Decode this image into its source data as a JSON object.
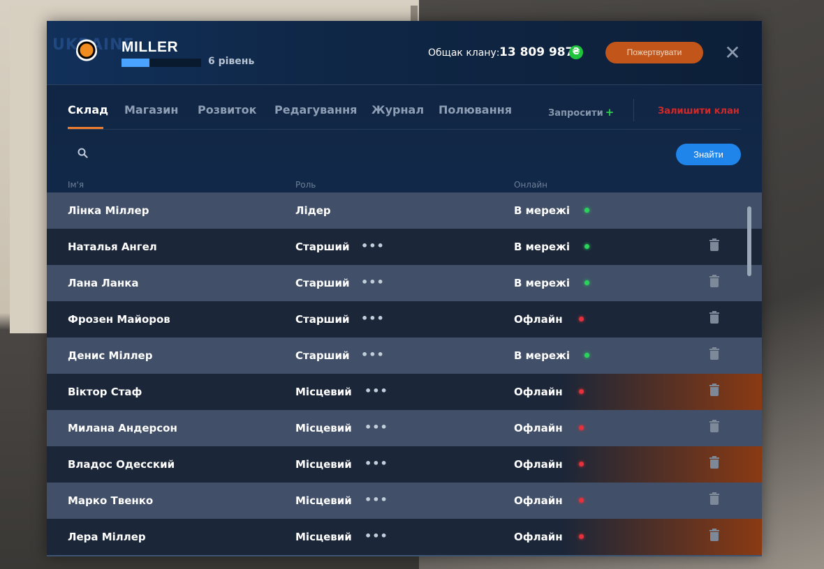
{
  "header": {
    "watermark": "UKRAINE",
    "clan_name": "MILLER",
    "level_text": "6 рівень",
    "level_progress": 0.35,
    "treasury_label": "Общак клану:",
    "treasury_value": "13 809 987",
    "currency_symbol": "₴",
    "donate_label": "Пожертвувати",
    "close_symbol": "✕"
  },
  "tabs": [
    {
      "label": "Склад",
      "active": true
    },
    {
      "label": "Магазин"
    },
    {
      "label": "Розвиток"
    },
    {
      "label": "Редагування"
    },
    {
      "label": "Журнал"
    },
    {
      "label": "Полювання"
    }
  ],
  "actions": {
    "invite_label": "Запросити",
    "invite_plus": "+",
    "leave_label": "Залишити клан"
  },
  "search": {
    "placeholder": "",
    "value": "",
    "button_label": "Знайти"
  },
  "columns": {
    "name": "Ім'я",
    "role": "Роль",
    "online": "Онлайн"
  },
  "more_symbol": "•••",
  "members": [
    {
      "name": "Лінка Міллер",
      "role": "Лідер",
      "status": "В мережі",
      "online": true
    },
    {
      "name": "Наталья Ангел",
      "role": "Старший",
      "status": "В мережі",
      "online": true
    },
    {
      "name": "Лана Ланка",
      "role": "Старший",
      "status": "В мережі",
      "online": true
    },
    {
      "name": "Фрозен Майоров",
      "role": "Старший",
      "status": "Офлайн",
      "online": false
    },
    {
      "name": "Денис Міллер",
      "role": "Старший",
      "status": "В мережі",
      "online": true
    },
    {
      "name": "Віктор Стаф",
      "role": "Місцевий",
      "status": "Офлайн",
      "online": false
    },
    {
      "name": "Милана Андерсон",
      "role": "Місцевий",
      "status": "Офлайн",
      "online": false
    },
    {
      "name": "Владос Одесский",
      "role": "Місцевий",
      "status": "Офлайн",
      "online": false
    },
    {
      "name": "Марко Твенко",
      "role": "Місцевий",
      "status": "Офлайн",
      "online": false
    },
    {
      "name": "Лера Міллер",
      "role": "Місцевий",
      "status": "Офлайн",
      "online": false
    }
  ],
  "colors": {
    "accent": "#f07d2e",
    "online": "#2ad35a",
    "offline": "#e6303a",
    "primary_button": "#1f85ea",
    "danger": "#d32828"
  }
}
